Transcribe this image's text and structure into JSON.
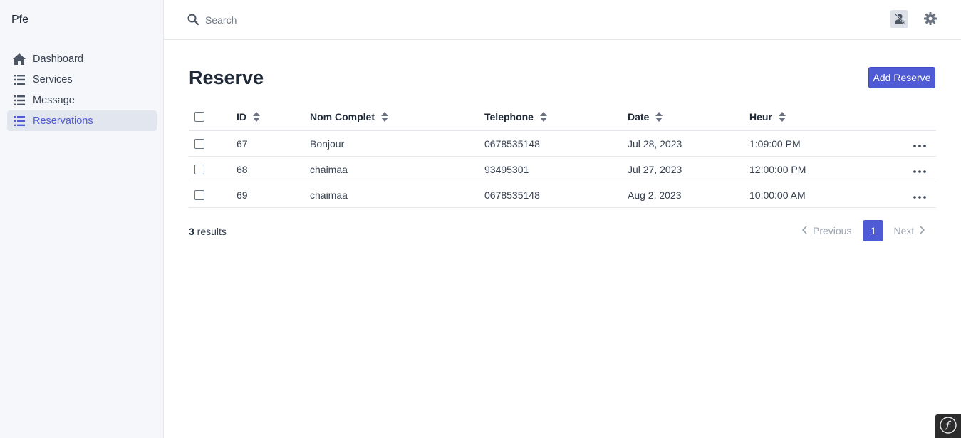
{
  "app": {
    "brand": "Pfe"
  },
  "sidebar": {
    "items": [
      {
        "label": "Dashboard",
        "icon": "home-icon"
      },
      {
        "label": "Services",
        "icon": "list-icon"
      },
      {
        "label": "Message",
        "icon": "list-icon"
      },
      {
        "label": "Reservations",
        "icon": "list-icon",
        "active": true
      }
    ]
  },
  "topbar": {
    "search": {
      "placeholder": "Search",
      "value": ""
    },
    "icons": [
      "search-icon",
      "user-icon",
      "gear-icon"
    ]
  },
  "page": {
    "title": "Reserve",
    "add_button": "Add Reserve"
  },
  "table": {
    "columns": [
      "ID",
      "Nom Complet",
      "Telephone",
      "Date",
      "Heur"
    ],
    "rows": [
      {
        "id": "67",
        "nom": "Bonjour",
        "tel": "0678535148",
        "date": "Jul 28, 2023",
        "heur": "1:09:00 PM"
      },
      {
        "id": "68",
        "nom": "chaimaa",
        "tel": "93495301",
        "date": "Jul 27, 2023",
        "heur": "12:00:00 PM"
      },
      {
        "id": "69",
        "nom": "chaimaa",
        "tel": "0678535148",
        "date": "Aug 2, 2023",
        "heur": "10:00:00 AM"
      }
    ]
  },
  "footer": {
    "results_count": "3",
    "results_label": " results",
    "pagination": {
      "previous": "Previous",
      "current": "1",
      "next": "Next"
    }
  },
  "colors": {
    "accent": "#4f5bd5",
    "sidebar_bg": "#f5f7fa",
    "active_item_bg": "#e2e6ee"
  }
}
